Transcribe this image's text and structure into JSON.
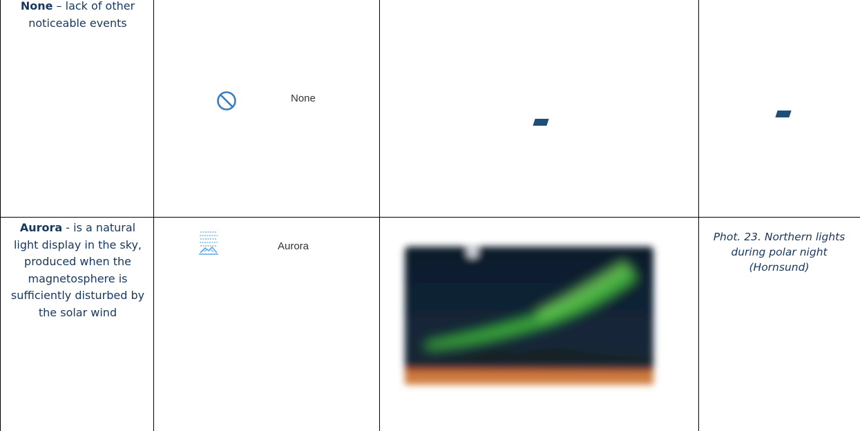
{
  "rows": [
    {
      "term": "None",
      "description": " – lack of other noticeable events",
      "icon": "prohibited-circle-icon",
      "icon_label": "None",
      "photo_cell": "-",
      "caption": "-"
    },
    {
      "term": "Aurora",
      "description": " - is a natural light display in the sky, produced when the magnetosphere is sufficiently disturbed by the solar wind",
      "icon": "aurora-icon",
      "icon_label": "Aurora",
      "caption": "Phot. 23. Northern lights during polar night (Hornsund)"
    }
  ],
  "colors": {
    "text": "#17375e",
    "icon": "#3a7cc0",
    "aurora_icon": "#5aa6e0",
    "dash": "#1f4e79"
  }
}
